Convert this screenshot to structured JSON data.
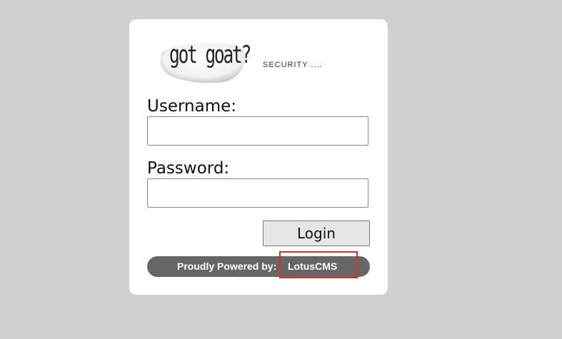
{
  "logo": {
    "text": "got goat?",
    "icon": "goat-logo-icon"
  },
  "tagline": "SECURITY ....",
  "form": {
    "username_label": "Username:",
    "username_value": "",
    "password_label": "Password:",
    "password_value": "",
    "login_label": "Login"
  },
  "footer": {
    "prefix": "Proudly Powered by:",
    "link_label": "LotusCMS"
  },
  "colors": {
    "page_background": "#d0d0d0",
    "card_background": "#ffffff",
    "footer_bar": "#666666",
    "highlight": "#e0302a"
  }
}
